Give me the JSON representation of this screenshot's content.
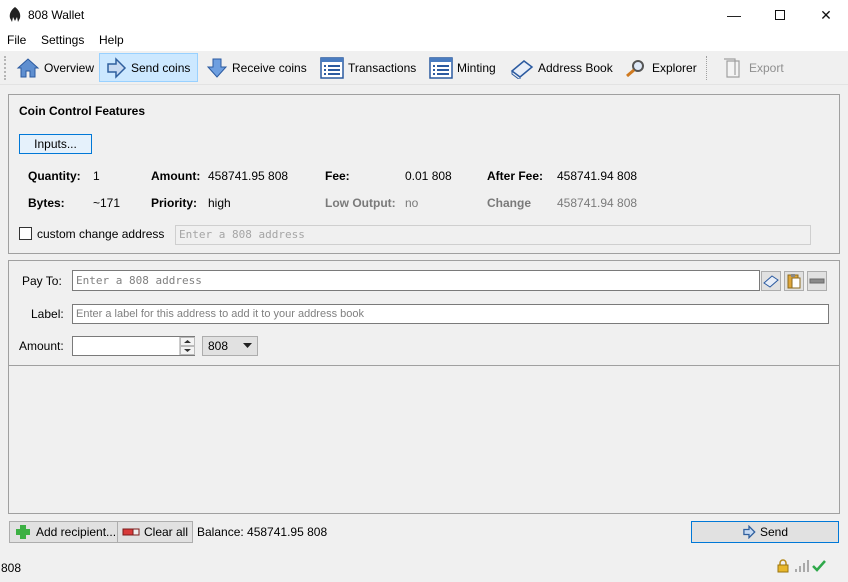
{
  "window": {
    "title": "808 Wallet"
  },
  "menu": {
    "file": "File",
    "settings": "Settings",
    "help": "Help"
  },
  "toolbar": {
    "overview": "Overview",
    "send": "Send coins",
    "receive": "Receive coins",
    "transactions": "Transactions",
    "minting": "Minting",
    "address_book": "Address Book",
    "explorer": "Explorer",
    "export": "Export"
  },
  "coin_control": {
    "title": "Coin Control Features",
    "inputs_button": "Inputs...",
    "quantity_label": "Quantity:",
    "quantity": "1",
    "amount_label": "Amount:",
    "amount": "458741.95 808",
    "fee_label": "Fee:",
    "fee": "0.01 808",
    "after_fee_label": "After Fee:",
    "after_fee": "458741.94 808",
    "bytes_label": "Bytes:",
    "bytes": "~171",
    "priority_label": "Priority:",
    "priority": "high",
    "low_output_label": "Low Output:",
    "low_output": "no",
    "change_label": "Change",
    "change": "458741.94 808",
    "custom_change_label": "custom change address",
    "custom_change_placeholder": "Enter a 808 address"
  },
  "pay": {
    "pay_to_label": "Pay To:",
    "pay_to_placeholder": "Enter a 808 address",
    "label_label": "Label:",
    "label_placeholder": "Enter a label for this address to add it to your address book",
    "amount_label": "Amount:",
    "amount_value": "",
    "unit": "808"
  },
  "bottom": {
    "add_recipient": "Add recipient...",
    "clear_all": "Clear all",
    "balance": "Balance: 458741.95 808",
    "send": "Send"
  },
  "statusbar": {
    "unit": "808"
  },
  "colors": {
    "accent": "#0078d7",
    "active_tab": "#cce8ff"
  }
}
